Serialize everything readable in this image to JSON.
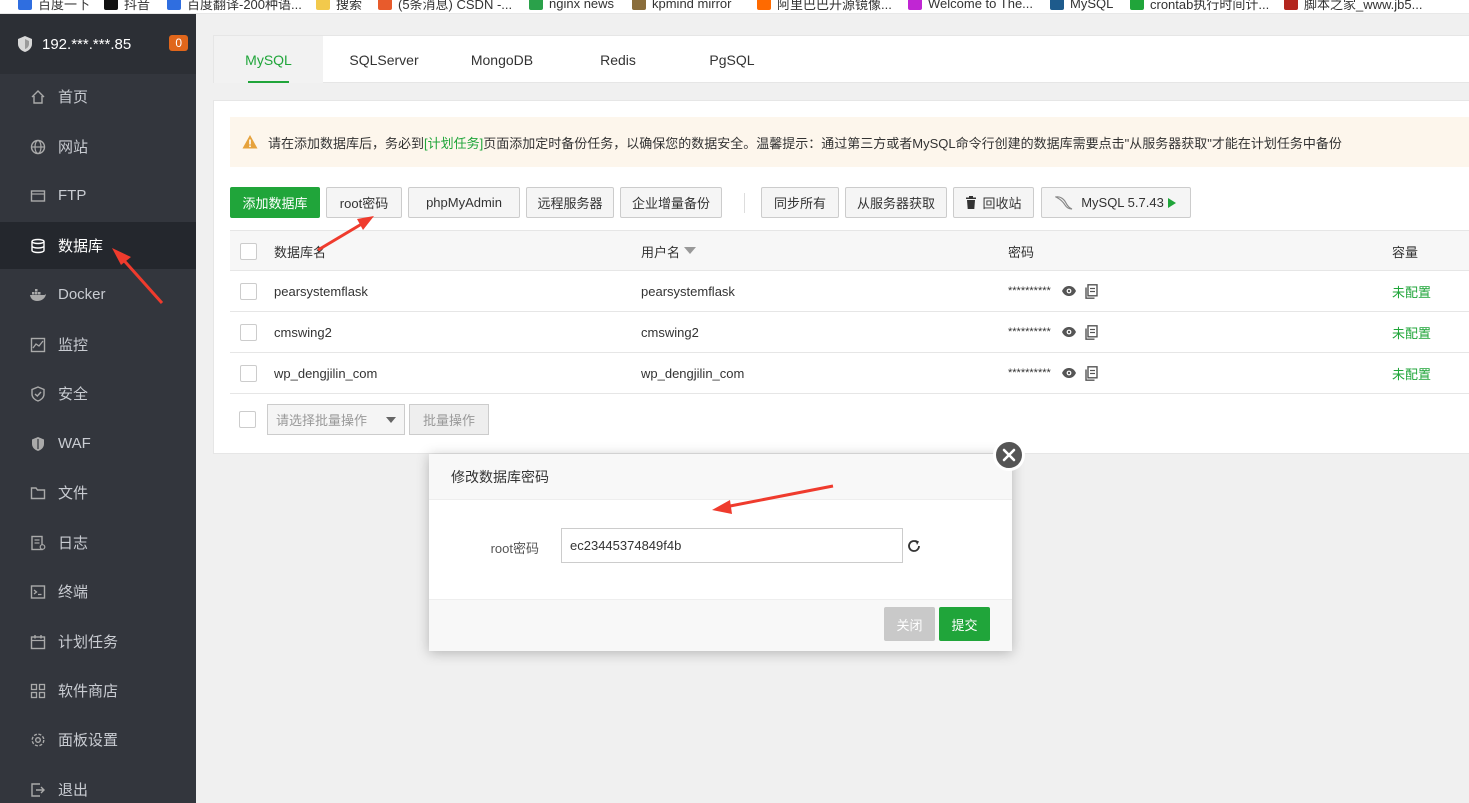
{
  "bookmarks": [
    {
      "label": "百度一下",
      "color": "#2f6ee0"
    },
    {
      "label": "抖音",
      "color": "#111111"
    },
    {
      "label": "百度翻译-200种语...",
      "color": "#2f6ee0"
    },
    {
      "label": "搜索",
      "color": "#f2c94c"
    },
    {
      "label": "(5条消息) CSDN -...",
      "color": "#e85b2c"
    },
    {
      "label": "nginx news",
      "color": "#2aa14a"
    },
    {
      "label": "kpmind mirror",
      "color": "#8a6d3b"
    },
    {
      "label": "阿里巴巴开源镜像...",
      "color": "#ff6a00"
    },
    {
      "label": "Welcome to The...",
      "color": "#c026d3"
    },
    {
      "label": "MySQL",
      "color": "#1e5b8c"
    },
    {
      "label": "crontab执行时间计...",
      "color": "#20a53a"
    },
    {
      "label": "脚本之家_www.jb5...",
      "color": "#b3261e"
    }
  ],
  "sidebar": {
    "server": "192.***.***.85",
    "badge": "0",
    "items": [
      {
        "label": "首页",
        "icon": "home-icon"
      },
      {
        "label": "网站",
        "icon": "globe-icon"
      },
      {
        "label": "FTP",
        "icon": "ftp-icon"
      },
      {
        "label": "数据库",
        "icon": "database-icon"
      },
      {
        "label": "Docker",
        "icon": "docker-icon"
      },
      {
        "label": "监控",
        "icon": "monitor-icon"
      },
      {
        "label": "安全",
        "icon": "shield-icon"
      },
      {
        "label": "WAF",
        "icon": "waf-icon"
      },
      {
        "label": "文件",
        "icon": "folder-icon"
      },
      {
        "label": "日志",
        "icon": "log-icon"
      },
      {
        "label": "终端",
        "icon": "terminal-icon"
      },
      {
        "label": "计划任务",
        "icon": "calendar-icon"
      },
      {
        "label": "软件商店",
        "icon": "apps-icon"
      },
      {
        "label": "面板设置",
        "icon": "settings-icon"
      },
      {
        "label": "退出",
        "icon": "logout-icon"
      }
    ]
  },
  "tabs": [
    "MySQL",
    "SQLServer",
    "MongoDB",
    "Redis",
    "PgSQL"
  ],
  "notice": {
    "before": "请在添加数据库后，务必到",
    "link": "[计划任务]",
    "after": "页面添加定时备份任务，以确保您的数据安全。温馨提示：通过第三方或者MySQL命令行创建的数据库需要点击\"从服务器获取\"才能在计划任务中备份"
  },
  "toolbar": {
    "add": "添加数据库",
    "root_pwd": "root密码",
    "phpmyadmin": "phpMyAdmin",
    "remote": "远程服务器",
    "enterprise": "企业增量备份",
    "sync_all": "同步所有",
    "fetch": "从服务器获取",
    "recycle": "回收站",
    "mysql_version": "MySQL 5.7.43"
  },
  "table": {
    "headers": {
      "name": "数据库名",
      "user": "用户名",
      "password": "密码",
      "capacity": "容量"
    },
    "rows": [
      {
        "name": "pearsystemflask",
        "user": "pearsystemflask",
        "password": "**********",
        "capacity": "未配置"
      },
      {
        "name": "cmswing2",
        "user": "cmswing2",
        "password": "**********",
        "capacity": "未配置"
      },
      {
        "name": "wp_dengjilin_com",
        "user": "wp_dengjilin_com",
        "password": "**********",
        "capacity": "未配置"
      }
    ]
  },
  "batch": {
    "placeholder": "请选择批量操作",
    "button": "批量操作"
  },
  "modal": {
    "title": "修改数据库密码",
    "label": "root密码",
    "value": "ec23445374849f4b",
    "cancel": "关闭",
    "submit": "提交"
  },
  "colors": {
    "accent": "#20a53a",
    "sidebar": "#33363d",
    "annotation_arrow": "#ef3b2d"
  }
}
